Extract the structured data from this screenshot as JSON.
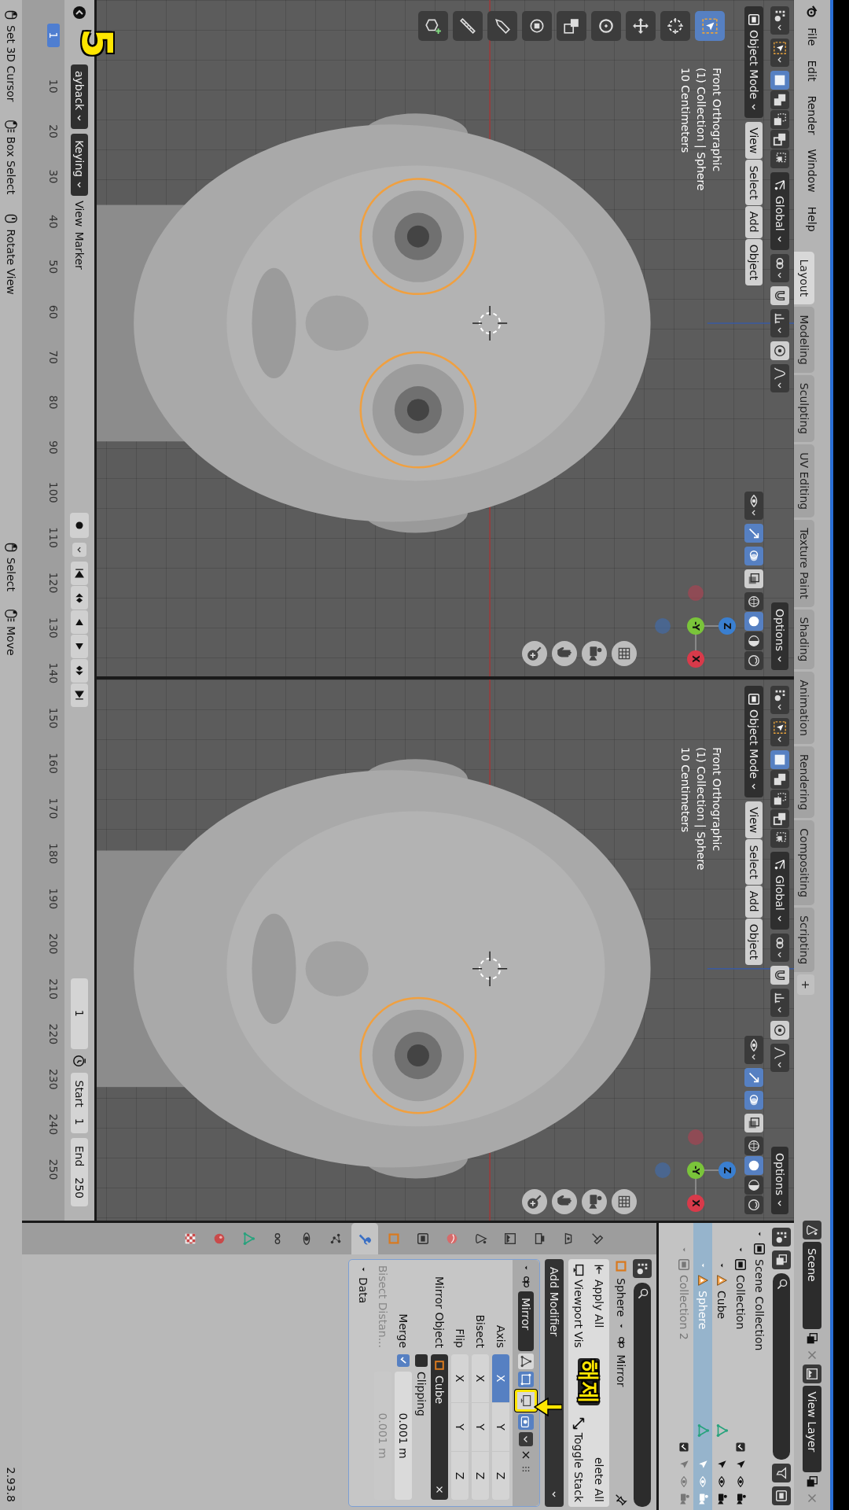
{
  "menu": [
    "File",
    "Edit",
    "Render",
    "Window",
    "Help"
  ],
  "workspaces": [
    {
      "label": "Layout",
      "selected": true
    },
    {
      "label": "Modeling",
      "selected": false
    },
    {
      "label": "Sculpting",
      "selected": false
    },
    {
      "label": "UV Editing",
      "selected": false
    },
    {
      "label": "Texture Paint",
      "selected": false
    },
    {
      "label": "Shading",
      "selected": false
    },
    {
      "label": "Animation",
      "selected": false
    },
    {
      "label": "Rendering",
      "selected": false
    },
    {
      "label": "Compositing",
      "selected": false
    },
    {
      "label": "Scripting",
      "selected": false
    }
  ],
  "add_workspace": "+",
  "scene": "Scene",
  "view_layer": "View Layer",
  "viewports": [
    {
      "mode": "Object Mode",
      "menus": [
        "View",
        "Select",
        "Add",
        "Object"
      ],
      "orientation": "Global",
      "options": "Options",
      "info": [
        "Front Orthographic",
        "(1) Collection | Sphere",
        "10 Centimeters"
      ],
      "axes": [
        "Z",
        "-Y",
        "X"
      ],
      "select_modes": [
        {
          "kind": "set",
          "selected": true
        },
        {
          "kind": "extend",
          "selected": false
        },
        {
          "kind": "subtract",
          "selected": false
        },
        {
          "kind": "invert",
          "selected": false
        },
        {
          "kind": "intersect",
          "selected": false
        }
      ],
      "overlays": [
        {
          "kind": "gizmo",
          "on": true
        },
        {
          "kind": "overlay",
          "on": true
        },
        {
          "kind": "xray",
          "on": false
        }
      ],
      "shading": [
        {
          "kind": "wireframe",
          "selected": false
        },
        {
          "kind": "solid",
          "selected": true
        },
        {
          "kind": "material",
          "selected": false
        },
        {
          "kind": "rendered",
          "selected": false
        }
      ],
      "tools": [
        {
          "kind": "select",
          "selected": true
        },
        {
          "kind": "cursor",
          "selected": false
        },
        {
          "kind": "move",
          "selected": false
        },
        {
          "kind": "rotate",
          "selected": false
        },
        {
          "kind": "scale",
          "selected": false
        },
        {
          "kind": "transform",
          "selected": false
        },
        {
          "kind": "annotate",
          "selected": false
        },
        {
          "kind": "measure",
          "selected": false
        },
        {
          "kind": "add_cube",
          "selected": false
        }
      ],
      "eyes": [
        {
          "selected": true
        },
        {
          "selected": true
        }
      ]
    },
    {
      "mode": "Object Mode",
      "menus": [
        "View",
        "Select",
        "Add",
        "Object"
      ],
      "orientation": "Global",
      "options": "Options",
      "info": [
        "Front Orthographic",
        "(1) Collection | Sphere",
        "10 Centimeters"
      ],
      "axes": [
        "Z",
        "-Y",
        "X"
      ],
      "select_modes": [
        {
          "kind": "set",
          "selected": true
        },
        {
          "kind": "extend",
          "selected": false
        },
        {
          "kind": "subtract",
          "selected": false
        },
        {
          "kind": "invert",
          "selected": false
        },
        {
          "kind": "intersect",
          "selected": false
        }
      ],
      "overlays": [
        {
          "kind": "gizmo",
          "on": true
        },
        {
          "kind": "overlay",
          "on": true
        },
        {
          "kind": "xray",
          "on": false
        }
      ],
      "shading": [
        {
          "kind": "wireframe",
          "selected": false
        },
        {
          "kind": "solid",
          "selected": true
        },
        {
          "kind": "material",
          "selected": false
        },
        {
          "kind": "rendered",
          "selected": false
        }
      ],
      "eyes": [
        {
          "selected": true
        }
      ]
    }
  ],
  "outliner": {
    "tree": [
      {
        "label": "Scene Collection",
        "kind": "scene",
        "selected": false,
        "disabled": false,
        "children": [
          {
            "label": "Collection",
            "kind": "collection",
            "selected": false,
            "disabled": false,
            "checked": true,
            "children": [
              {
                "label": "Cube",
                "kind": "object",
                "selected": false,
                "disabled": false
              },
              {
                "label": "Sphere",
                "kind": "object",
                "selected": true,
                "disabled": false
              }
            ]
          },
          {
            "label": "Collection 2",
            "kind": "collection",
            "selected": false,
            "disabled": true,
            "checked": true
          }
        ]
      }
    ]
  },
  "property_tabs": [
    {
      "kind": "tool",
      "selected": false
    },
    {
      "kind": "render",
      "selected": false
    },
    {
      "kind": "output",
      "selected": false
    },
    {
      "kind": "view_layer",
      "selected": false
    },
    {
      "kind": "scene",
      "selected": false
    },
    {
      "kind": "world",
      "selected": false
    },
    {
      "kind": "collection",
      "selected": false
    },
    {
      "kind": "object",
      "selected": false
    },
    {
      "kind": "modifiers",
      "selected": true
    },
    {
      "kind": "particles",
      "selected": false
    },
    {
      "kind": "physics",
      "selected": false
    },
    {
      "kind": "constraints",
      "selected": false
    },
    {
      "kind": "data",
      "selected": false
    },
    {
      "kind": "material",
      "selected": false
    },
    {
      "kind": "texture",
      "selected": false
    }
  ],
  "properties": {
    "object": "Sphere",
    "modifier": "Mirror",
    "apply_all": "Apply All",
    "delete_all": "elete All",
    "viewport_vis": "Viewport Vis",
    "toggle_stack": "Toggle Stack",
    "add_modifier": "Add Modifier",
    "panel": {
      "name": "Mirror",
      "toggles": [
        {
          "kind": "on_cage",
          "on": false,
          "annotated": false
        },
        {
          "kind": "edit_mode",
          "on": true,
          "annotated": false
        },
        {
          "kind": "viewport",
          "on": false,
          "annotated": true
        },
        {
          "kind": "render",
          "on": true,
          "annotated": false
        }
      ],
      "axis_rows": [
        {
          "label": "Axis",
          "buttons": [
            {
              "label": "X",
              "selected": true
            },
            {
              "label": "Y",
              "selected": false
            },
            {
              "label": "Z",
              "selected": false
            }
          ]
        },
        {
          "label": "Bisect",
          "buttons": [
            {
              "label": "X",
              "selected": false
            },
            {
              "label": "Y",
              "selected": false
            },
            {
              "label": "Z",
              "selected": false
            }
          ]
        },
        {
          "label": "Flip",
          "buttons": [
            {
              "label": "X",
              "selected": false
            },
            {
              "label": "Y",
              "selected": false
            },
            {
              "label": "Z",
              "selected": false
            }
          ]
        }
      ],
      "mirror_object_label": "Mirror Object",
      "mirror_object": "Cube",
      "clipping": {
        "label": "Clipping",
        "checked": false
      },
      "merge": {
        "label": "Merge",
        "checked": true,
        "value": "0.001 m"
      },
      "bisect_distance": {
        "label": "Bisect Distan...",
        "value": "0.001 m",
        "disabled": true
      },
      "data_section": "Data"
    }
  },
  "annotations": {
    "step": "5",
    "note": "해제"
  },
  "timeline": {
    "menus": [
      {
        "label": "ayback",
        "kind": "dropdown"
      },
      {
        "label": "Keying",
        "kind": "dropdown"
      },
      {
        "label": "View",
        "kind": "menu"
      },
      {
        "label": "Marker",
        "kind": "menu"
      }
    ],
    "current_frame": "1",
    "start_label": "Start",
    "start": "1",
    "end_label": "End",
    "end": "250",
    "ruler_current": "1",
    "ruler": [
      "10",
      "20",
      "30",
      "40",
      "50",
      "60",
      "70",
      "80",
      "90",
      "100",
      "110",
      "120",
      "130",
      "140",
      "150",
      "160",
      "170",
      "180",
      "190",
      "200",
      "210",
      "220",
      "230",
      "240",
      "250"
    ]
  },
  "status": {
    "hints": [
      {
        "label": "Set 3D Cursor",
        "kind": "left"
      },
      {
        "label": "Box Select",
        "kind": "drag"
      },
      {
        "label": "Rotate View",
        "kind": "middle"
      },
      {
        "label": "Select",
        "kind": "left"
      },
      {
        "label": "Move",
        "kind": "drag"
      }
    ],
    "version": "2.93.8"
  }
}
